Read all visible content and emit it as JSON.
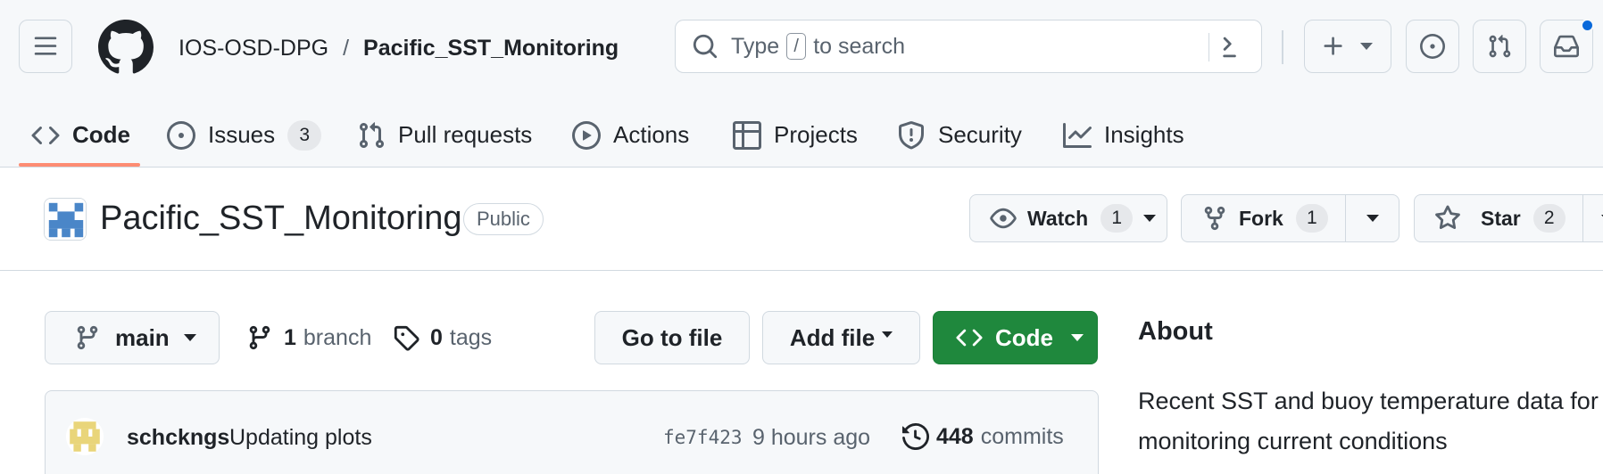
{
  "header": {
    "owner": "IOS-OSD-DPG",
    "separator": "/",
    "repo": "Pacific_SST_Monitoring",
    "search": {
      "prefix": "Type",
      "key": "/",
      "suffix": "to search"
    }
  },
  "tabs": [
    {
      "label": "Code",
      "icon": "code-icon",
      "active": true
    },
    {
      "label": "Issues",
      "icon": "issue-opened-icon",
      "count": "3"
    },
    {
      "label": "Pull requests",
      "icon": "git-pull-request-icon"
    },
    {
      "label": "Actions",
      "icon": "play-icon"
    },
    {
      "label": "Projects",
      "icon": "table-icon"
    },
    {
      "label": "Security",
      "icon": "shield-icon"
    },
    {
      "label": "Insights",
      "icon": "graph-icon"
    }
  ],
  "repo": {
    "name": "Pacific_SST_Monitoring",
    "visibility": "Public",
    "watch": {
      "label": "Watch",
      "count": "1"
    },
    "fork": {
      "label": "Fork",
      "count": "1"
    },
    "star": {
      "label": "Star",
      "count": "2"
    }
  },
  "toolbar": {
    "branch": "main",
    "branches_count": "1",
    "branches_label": "branch",
    "tags_count": "0",
    "tags_label": "tags",
    "goto_file": "Go to file",
    "add_file": "Add file",
    "code": "Code"
  },
  "commit": {
    "author": "schckngs",
    "message": "Updating plots",
    "sha": "fe7f423",
    "time": "9 hours ago",
    "count": "448",
    "count_label": "commits"
  },
  "about": {
    "title": "About",
    "description": "Recent SST and buoy temperature data for monitoring current conditions"
  },
  "colors": {
    "accent_green": "#1f883d",
    "tab_underline": "#fd8c73",
    "notification": "#0969da"
  }
}
